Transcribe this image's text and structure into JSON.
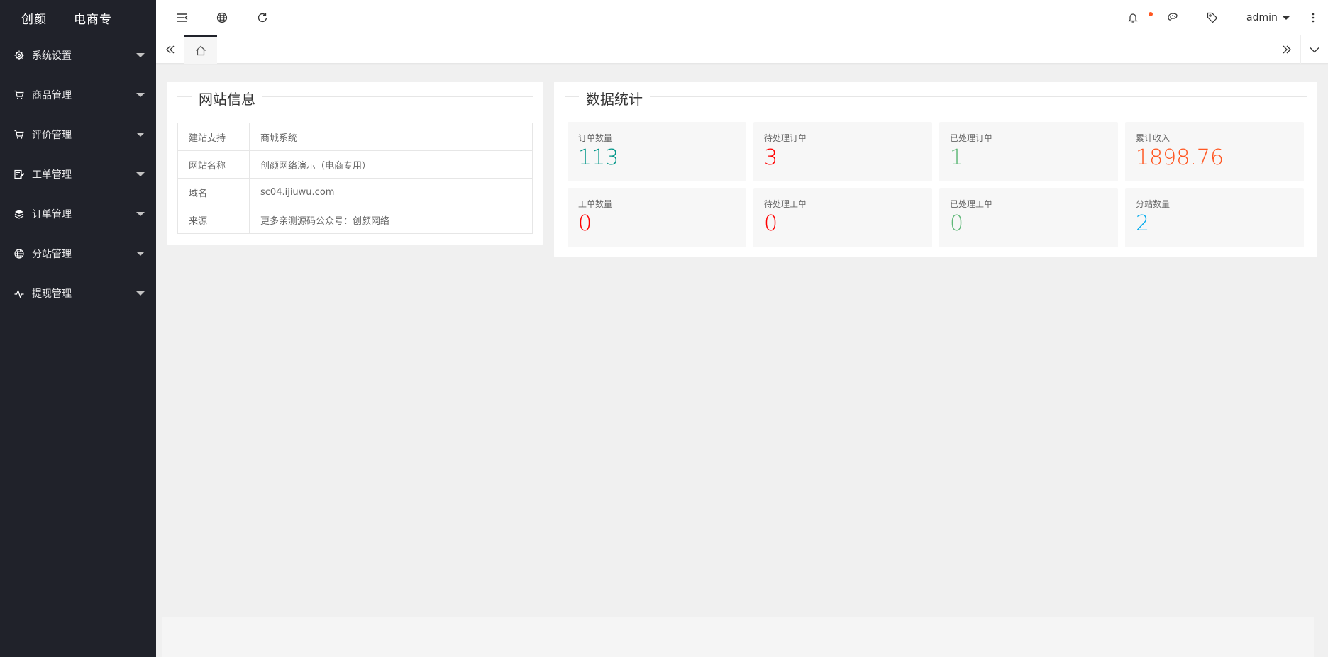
{
  "app": {
    "logo_text": "创颜网络演示（电商专用）",
    "logo_display": "创颜    电商专"
  },
  "sidebar": {
    "items": [
      {
        "label": "系统设置",
        "icon": "gear-icon"
      },
      {
        "label": "商品管理",
        "icon": "cart-icon"
      },
      {
        "label": "评价管理",
        "icon": "cart-icon"
      },
      {
        "label": "工单管理",
        "icon": "edit-icon"
      },
      {
        "label": "订单管理",
        "icon": "layers-icon"
      },
      {
        "label": "分站管理",
        "icon": "globe-icon"
      },
      {
        "label": "提现管理",
        "icon": "pulse-icon"
      }
    ]
  },
  "header": {
    "user": "admin",
    "notification_dot_color": "#ff5722"
  },
  "site_info": {
    "title": "网站信息",
    "rows": [
      {
        "key": "建站支持",
        "value": "商城系统"
      },
      {
        "key": "网站名称",
        "value": "创颜网络演示（电商专用）"
      },
      {
        "key": "域名",
        "value": "sc04.ijiuwu.com"
      },
      {
        "key": "来源",
        "value": "更多亲测源码公众号：创颜网络"
      }
    ]
  },
  "stats": {
    "title": "数据统计",
    "items": [
      {
        "label": "订单数量",
        "value": "113",
        "color": "#009688"
      },
      {
        "label": "待处理订单",
        "value": "3",
        "color": "#ff0000"
      },
      {
        "label": "已处理订单",
        "value": "1",
        "color": "#5fb878"
      },
      {
        "label": "累计收入",
        "value": "1898.76",
        "color": "#ff5722"
      },
      {
        "label": "工单数量",
        "value": "0",
        "color": "#ff0000"
      },
      {
        "label": "待处理工单",
        "value": "0",
        "color": "#ff0000"
      },
      {
        "label": "已处理工单",
        "value": "0",
        "color": "#5fb878"
      },
      {
        "label": "分站数量",
        "value": "2",
        "color": "#01aaed"
      }
    ]
  }
}
